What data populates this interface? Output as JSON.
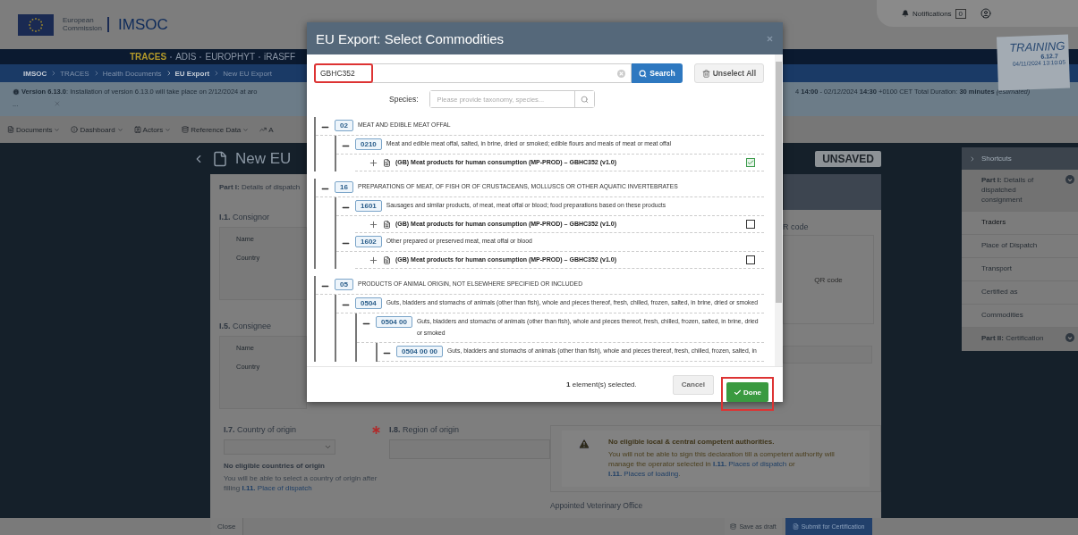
{
  "header": {
    "org_line1": "European",
    "org_line2": "Commission",
    "app": "IMSOC",
    "notifications_label": "Notifications",
    "notifications_count": "0"
  },
  "env_badge": {
    "title": "TRAINING",
    "version": "6.12.7",
    "timestamp": "04/11/2024 13:10:05"
  },
  "systems": [
    {
      "label": "TRACES",
      "selected": true
    },
    {
      "label": "ADIS",
      "selected": false
    },
    {
      "label": "EUROPHYT",
      "selected": false
    },
    {
      "label": "iRASFF",
      "selected": false
    }
  ],
  "breadcrumb": [
    {
      "label": "IMSOC",
      "emphasis": true
    },
    {
      "label": "TRACES",
      "emphasis": false
    },
    {
      "label": "Health Documents",
      "emphasis": false
    },
    {
      "label": "EU Export",
      "emphasis": true
    },
    {
      "label": "New EU Export",
      "emphasis": false
    }
  ],
  "alert": {
    "left_text": "**Version 6.13.0**: Installation of version 6.13.0 will take place on 2/12/2024 at aro",
    "left_more": "...",
    "right_text": "4 **14:00** - 02/12/2024 **14:30** +0100 CET Total Duration: **30 minutes** *(estimated)*"
  },
  "menu": [
    {
      "label": "Documents"
    },
    {
      "label": "Dashboard"
    },
    {
      "label": "Actors"
    },
    {
      "label": "Reference Data"
    },
    {
      "label": "A"
    }
  ],
  "page": {
    "title": "New EU",
    "status": "UNSAVED",
    "part_label": "**Part I:** Details of dispatch"
  },
  "consignor": {
    "label": "**I.1.** Consignor",
    "fields": [
      "Name",
      "Country"
    ]
  },
  "consignee": {
    "label": "**I.5.** Consignee",
    "fields": [
      "Name",
      "Country"
    ]
  },
  "qr": {
    "label": "R code",
    "placeholder": "QR code"
  },
  "country_of_origin": {
    "label": "**I.7.** Country of origin",
    "required": true,
    "empty_title": "No eligible countries of origin",
    "hint": "You will be able to select a country of origin after filling",
    "link": "**I.11.** Place of dispatch"
  },
  "region_of_origin": {
    "label": "**I.8.** Region of origin"
  },
  "authority_warning": {
    "title": "No eligible local & central competent authorities.",
    "text": "You will not be able to sign this declaration till a competent authority will manage the operator selected in",
    "link1": "**I.11.** Places of dispatch",
    "middle": "or",
    "link2": "**I.11.** Places of loading",
    "end": "."
  },
  "appointed_office_label": "Appointed Veterinary Office",
  "shortcuts": {
    "title": "Shortcuts",
    "items": [
      {
        "kind": "part",
        "label": "**Part I:** Details of dispatched consignment",
        "selected": false
      },
      {
        "kind": "link",
        "label": "Traders",
        "selected": true
      },
      {
        "kind": "link",
        "label": "Place of Dispatch",
        "selected": false
      },
      {
        "kind": "link",
        "label": "Transport",
        "selected": false
      },
      {
        "kind": "link",
        "label": "Certified as",
        "selected": false
      },
      {
        "kind": "link",
        "label": "Commodities",
        "selected": false
      },
      {
        "kind": "part",
        "label": "**Part II:** Certification",
        "selected": false
      }
    ]
  },
  "bottom_bar": {
    "close": "Close",
    "save": "Save as draft",
    "submit": "Submit for Certification"
  },
  "modal": {
    "title": "EU Export: Select Commodities",
    "search_value": "GBHC352",
    "search_button": "Search",
    "unselect_button": "Unselect All",
    "species_label": "Species:",
    "species_placeholder": "Please provide taxonomy, species...",
    "tree": [
      {
        "kind": "code",
        "code": "02",
        "label": "MEAT AND EDIBLE MEAT OFFAL",
        "expanded": true,
        "children": [
          {
            "kind": "code",
            "code": "0210",
            "label": "Meat and edible meat offal, salted, in brine, dried or smoked; edible flours and meals of meat or meat offal",
            "expanded": true,
            "children": [
              {
                "kind": "certificate",
                "label": "(GB) Meat products for human consumption (MP-PROD) – GBHC352 (v1.0)",
                "expanded": false,
                "checked": true
              }
            ]
          }
        ]
      },
      {
        "kind": "code",
        "code": "16",
        "label": "PREPARATIONS OF MEAT, OF FISH OR OF CRUSTACEANS, MOLLUSCS OR OTHER AQUATIC INVERTEBRATES",
        "expanded": true,
        "children": [
          {
            "kind": "code",
            "code": "1601",
            "label": "Sausages and similar products, of meat, meat offal or blood; food preparations based on these products",
            "expanded": true,
            "children": [
              {
                "kind": "certificate",
                "label": "(GB) Meat products for human consumption (MP-PROD) – GBHC352 (v1.0)",
                "expanded": false,
                "checked": false
              }
            ]
          },
          {
            "kind": "code",
            "code": "1602",
            "label": "Other prepared or preserved meat, meat offal or blood",
            "expanded": true,
            "children": [
              {
                "kind": "certificate",
                "label": "(GB) Meat products for human consumption (MP-PROD) – GBHC352 (v1.0)",
                "expanded": false,
                "checked": false
              }
            ]
          }
        ]
      },
      {
        "kind": "code",
        "code": "05",
        "label": "PRODUCTS OF ANIMAL ORIGIN, NOT ELSEWHERE SPECIFIED OR INCLUDED",
        "expanded": true,
        "children": [
          {
            "kind": "code",
            "code": "0504",
            "label": "Guts, bladders and stomachs of animals (other than fish), whole and pieces thereof, fresh, chilled, frozen, salted, in brine, dried or smoked",
            "expanded": true,
            "children": [
              {
                "kind": "code",
                "code": "0504 00",
                "label": "Guts, bladders and stomachs of animals (other than fish), whole and pieces thereof, fresh, chilled, frozen, salted, in brine, dried or smoked",
                "expanded": true,
                "children": [
                  {
                    "kind": "code",
                    "code": "0504 00 00",
                    "label": "Guts, bladders and stomachs of animals (other than fish), whole and pieces thereof, fresh, chilled, frozen, salted, in",
                    "expanded": true
                  }
                ]
              }
            ]
          }
        ]
      }
    ],
    "selected_count": "**1** element(s) selected.",
    "cancel_button": "Cancel",
    "done_button": "Done"
  }
}
